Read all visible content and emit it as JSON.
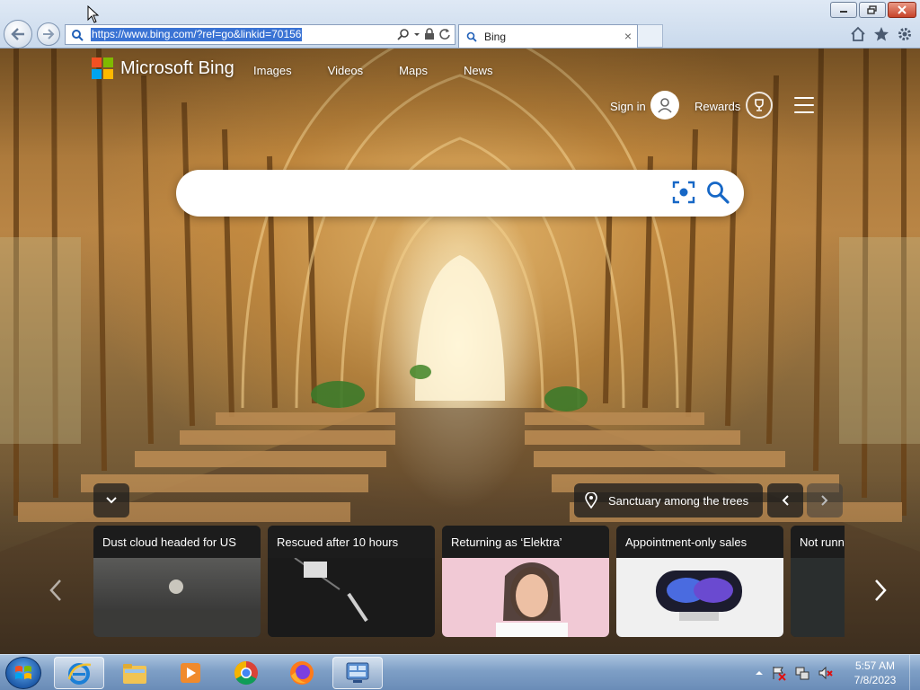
{
  "browser": {
    "url": "https://www.bing.com/?ref=go&linkid=70156",
    "tab_title": "Bing"
  },
  "bing": {
    "logo_text": "Microsoft Bing",
    "logo_colors": [
      "#f25022",
      "#7fba00",
      "#00a4ef",
      "#ffb900"
    ],
    "nav": [
      "Images",
      "Videos",
      "Maps",
      "News"
    ],
    "sign_in": "Sign in",
    "rewards": "Rewards",
    "search_placeholder": "",
    "image_caption": "Sanctuary among the trees"
  },
  "news_cards": [
    {
      "title": "Dust cloud headed for US"
    },
    {
      "title": "Rescued after 10 hours"
    },
    {
      "title": "Returning as ‘Elektra’"
    },
    {
      "title": "Appointment-only sales"
    },
    {
      "title": "Not runn"
    }
  ],
  "taskbar": {
    "items": [
      "start-orb",
      "internet-explorer",
      "file-explorer",
      "media-player",
      "chrome",
      "firefox",
      "control-panel"
    ],
    "clock_time": "5:57 AM",
    "clock_date": "7/8/2023"
  }
}
